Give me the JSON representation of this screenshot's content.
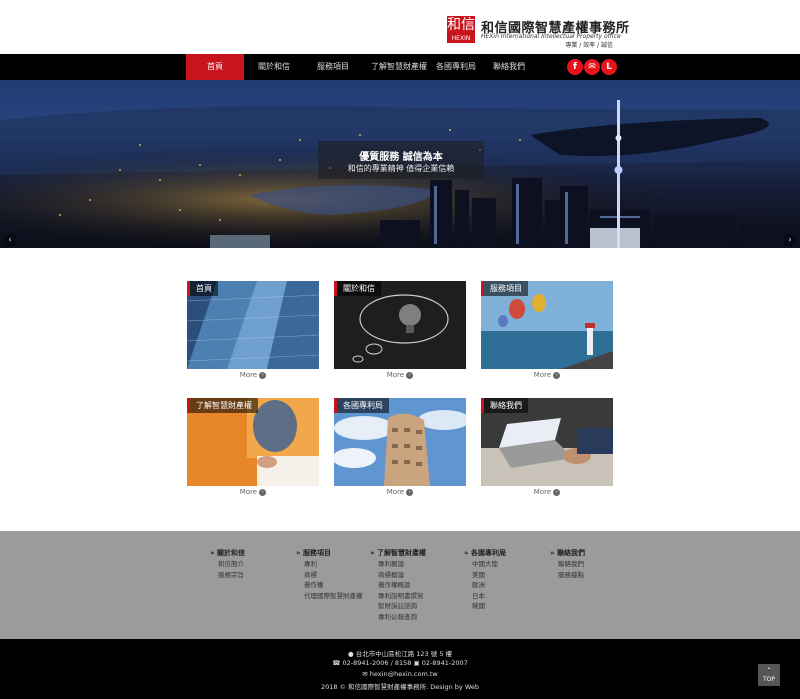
{
  "header": {
    "logo_mark": "和信",
    "logo_mark_en": "HEXIN",
    "logo_cn": "和信國際智慧產權事務所",
    "logo_en": "HEXin International Intellectual Property office",
    "logo_tag": "專業 / 效率 / 誠信"
  },
  "nav": {
    "items": [
      "首頁",
      "關於和信",
      "服務項目",
      "了解智慧財產權",
      "各國專利局",
      "聯絡我們"
    ],
    "active_index": 0,
    "social": [
      "facebook-icon",
      "mail-icon",
      "line-icon"
    ],
    "social_glyphs": [
      "f",
      "✉",
      "L"
    ]
  },
  "banner": {
    "line1": "優質服務 誠信為本",
    "line2": "和信的專業精神 值得企業信賴",
    "prev": "‹",
    "next": "›"
  },
  "cards": [
    {
      "label": "首頁",
      "more": "More"
    },
    {
      "label": "關於和信",
      "more": "More"
    },
    {
      "label": "服務項目",
      "more": "More"
    },
    {
      "label": "了解智慧財產權",
      "more": "More"
    },
    {
      "label": "各國專利局",
      "more": "More"
    },
    {
      "label": "聯絡我們",
      "more": "More"
    }
  ],
  "footer": {
    "columns": [
      {
        "title": "» 關於和信",
        "items": [
          "和信簡介",
          "服務宗旨"
        ]
      },
      {
        "title": "» 服務項目",
        "items": [
          "專利",
          "商標",
          "著作權",
          "代理國際智慧財產權"
        ]
      },
      {
        "title": "» 了解智慧財產權",
        "items": [
          "專利概論",
          "商標概論",
          "著作權概論",
          "專利說明書撰寫",
          "智財訴訟諮詢",
          "專利公報查詢"
        ]
      },
      {
        "title": "» 各國專利局",
        "items": [
          "中國大陸",
          "美國",
          "歐洲",
          "日本",
          "韓國"
        ]
      },
      {
        "title": "» 聯絡我們",
        "items": [
          "聯絡我們",
          "服務據點"
        ]
      }
    ],
    "address": "台北市中山區松江路 123 號 5 樓",
    "phone": "02-8941-2006 / 8158",
    "fax": "02-8941-2007",
    "email": "hexin@hexin.com.tw",
    "copyright": "2018 © 和信國際智慧財產權事務所. Design by Web",
    "top_label": "TOP"
  },
  "colors": {
    "brand_red": "#c8141c",
    "nav_bg": "#000000",
    "footer_gray": "#9b9b9b"
  }
}
